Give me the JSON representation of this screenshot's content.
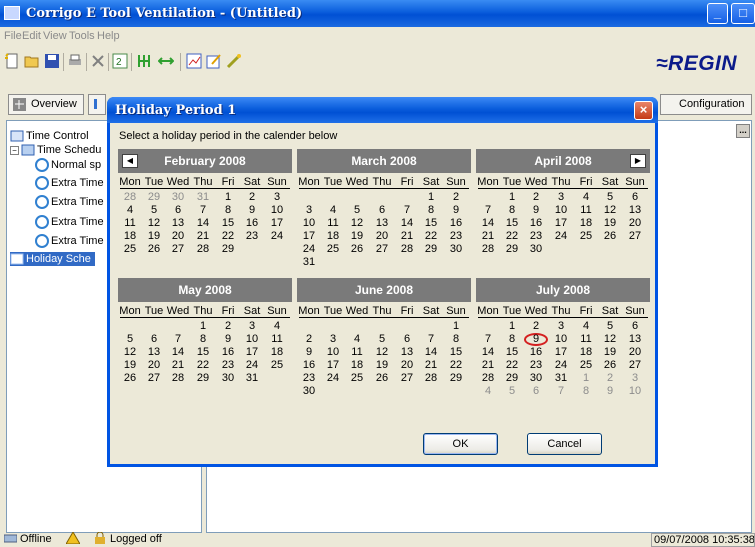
{
  "window": {
    "title": "Corrigo E Tool Ventilation - (Untitled)",
    "min": "_",
    "max": "□"
  },
  "menu": [
    {
      "label": "File"
    },
    {
      "label": "Edit"
    },
    {
      "label": "View"
    },
    {
      "label": "Tools"
    },
    {
      "label": "Help"
    }
  ],
  "toolbar": {
    "logo": "≈REGIN"
  },
  "tabs": {
    "overview": "Overview",
    "configuration": "Configuration"
  },
  "tree": {
    "items": [
      "Time Control",
      "Time Schedu",
      "Normal sp",
      "Extra Time",
      "Extra Time",
      "Extra Time",
      "Extra Time",
      "Holiday Sche"
    ]
  },
  "more_button": "...",
  "status": {
    "offline": "Offline",
    "logged": "Logged off",
    "datetime": "09/07/2008 10:35:38"
  },
  "dialog": {
    "title": "Holiday Period 1",
    "close": "×",
    "instruction": "Select a holiday period in the calender below",
    "ok": "OK",
    "cancel": "Cancel",
    "weekdays": [
      "Mon",
      "Tue",
      "Wed",
      "Thu",
      "Fri",
      "Sat",
      "Sun"
    ],
    "months": [
      {
        "name": "February 2008",
        "nav": "prev",
        "rows": [
          [
            {
              "d": "28",
              "o": 1
            },
            {
              "d": "29",
              "o": 1
            },
            {
              "d": "30",
              "o": 1
            },
            {
              "d": "31",
              "o": 1
            },
            {
              "d": "1"
            },
            {
              "d": "2"
            },
            {
              "d": "3"
            }
          ],
          [
            {
              "d": "4"
            },
            {
              "d": "5"
            },
            {
              "d": "6"
            },
            {
              "d": "7"
            },
            {
              "d": "8"
            },
            {
              "d": "9"
            },
            {
              "d": "10"
            }
          ],
          [
            {
              "d": "11"
            },
            {
              "d": "12"
            },
            {
              "d": "13"
            },
            {
              "d": "14"
            },
            {
              "d": "15"
            },
            {
              "d": "16"
            },
            {
              "d": "17"
            }
          ],
          [
            {
              "d": "18"
            },
            {
              "d": "19"
            },
            {
              "d": "20"
            },
            {
              "d": "21"
            },
            {
              "d": "22"
            },
            {
              "d": "23"
            },
            {
              "d": "24"
            }
          ],
          [
            {
              "d": "25"
            },
            {
              "d": "26"
            },
            {
              "d": "27"
            },
            {
              "d": "28"
            },
            {
              "d": "29"
            }
          ]
        ]
      },
      {
        "name": "March 2008",
        "nav": "",
        "rows": [
          [
            {
              "d": ""
            },
            {
              "d": ""
            },
            {
              "d": ""
            },
            {
              "d": ""
            },
            {
              "d": ""
            },
            {
              "d": "1"
            },
            {
              "d": "2"
            }
          ],
          [
            {
              "d": "3"
            },
            {
              "d": "4"
            },
            {
              "d": "5"
            },
            {
              "d": "6"
            },
            {
              "d": "7"
            },
            {
              "d": "8"
            },
            {
              "d": "9"
            }
          ],
          [
            {
              "d": "10"
            },
            {
              "d": "11"
            },
            {
              "d": "12"
            },
            {
              "d": "13"
            },
            {
              "d": "14"
            },
            {
              "d": "15"
            },
            {
              "d": "16"
            }
          ],
          [
            {
              "d": "17"
            },
            {
              "d": "18"
            },
            {
              "d": "19"
            },
            {
              "d": "20"
            },
            {
              "d": "21"
            },
            {
              "d": "22"
            },
            {
              "d": "23"
            }
          ],
          [
            {
              "d": "24"
            },
            {
              "d": "25"
            },
            {
              "d": "26"
            },
            {
              "d": "27"
            },
            {
              "d": "28"
            },
            {
              "d": "29"
            },
            {
              "d": "30"
            }
          ],
          [
            {
              "d": "31"
            }
          ]
        ]
      },
      {
        "name": "April 2008",
        "nav": "next",
        "rows": [
          [
            {
              "d": ""
            },
            {
              "d": "1"
            },
            {
              "d": "2"
            },
            {
              "d": "3"
            },
            {
              "d": "4"
            },
            {
              "d": "5"
            },
            {
              "d": "6"
            }
          ],
          [
            {
              "d": "7"
            },
            {
              "d": "8"
            },
            {
              "d": "9"
            },
            {
              "d": "10"
            },
            {
              "d": "11"
            },
            {
              "d": "12"
            },
            {
              "d": "13"
            }
          ],
          [
            {
              "d": "14"
            },
            {
              "d": "15"
            },
            {
              "d": "16"
            },
            {
              "d": "17"
            },
            {
              "d": "18"
            },
            {
              "d": "19"
            },
            {
              "d": "20"
            }
          ],
          [
            {
              "d": "21"
            },
            {
              "d": "22"
            },
            {
              "d": "23"
            },
            {
              "d": "24"
            },
            {
              "d": "25"
            },
            {
              "d": "26"
            },
            {
              "d": "27"
            }
          ],
          [
            {
              "d": "28"
            },
            {
              "d": "29"
            },
            {
              "d": "30"
            }
          ]
        ]
      },
      {
        "name": "May 2008",
        "nav": "",
        "rows": [
          [
            {
              "d": ""
            },
            {
              "d": ""
            },
            {
              "d": ""
            },
            {
              "d": "1"
            },
            {
              "d": "2"
            },
            {
              "d": "3"
            },
            {
              "d": "4"
            }
          ],
          [
            {
              "d": "5"
            },
            {
              "d": "6"
            },
            {
              "d": "7"
            },
            {
              "d": "8"
            },
            {
              "d": "9"
            },
            {
              "d": "10"
            },
            {
              "d": "11"
            }
          ],
          [
            {
              "d": "12"
            },
            {
              "d": "13"
            },
            {
              "d": "14"
            },
            {
              "d": "15"
            },
            {
              "d": "16"
            },
            {
              "d": "17"
            },
            {
              "d": "18"
            }
          ],
          [
            {
              "d": "19"
            },
            {
              "d": "20"
            },
            {
              "d": "21"
            },
            {
              "d": "22"
            },
            {
              "d": "23"
            },
            {
              "d": "24"
            },
            {
              "d": "25"
            }
          ],
          [
            {
              "d": "26"
            },
            {
              "d": "27"
            },
            {
              "d": "28"
            },
            {
              "d": "29"
            },
            {
              "d": "30"
            },
            {
              "d": "31"
            }
          ]
        ]
      },
      {
        "name": "June 2008",
        "nav": "",
        "rows": [
          [
            {
              "d": ""
            },
            {
              "d": ""
            },
            {
              "d": ""
            },
            {
              "d": ""
            },
            {
              "d": ""
            },
            {
              "d": ""
            },
            {
              "d": "1"
            }
          ],
          [
            {
              "d": "2"
            },
            {
              "d": "3"
            },
            {
              "d": "4"
            },
            {
              "d": "5"
            },
            {
              "d": "6"
            },
            {
              "d": "7"
            },
            {
              "d": "8"
            }
          ],
          [
            {
              "d": "9"
            },
            {
              "d": "10"
            },
            {
              "d": "11"
            },
            {
              "d": "12"
            },
            {
              "d": "13"
            },
            {
              "d": "14"
            },
            {
              "d": "15"
            }
          ],
          [
            {
              "d": "16"
            },
            {
              "d": "17"
            },
            {
              "d": "18"
            },
            {
              "d": "19"
            },
            {
              "d": "20"
            },
            {
              "d": "21"
            },
            {
              "d": "22"
            }
          ],
          [
            {
              "d": "23"
            },
            {
              "d": "24"
            },
            {
              "d": "25"
            },
            {
              "d": "26"
            },
            {
              "d": "27"
            },
            {
              "d": "28"
            },
            {
              "d": "29"
            }
          ],
          [
            {
              "d": "30"
            }
          ]
        ]
      },
      {
        "name": "July 2008",
        "nav": "",
        "rows": [
          [
            {
              "d": ""
            },
            {
              "d": "1"
            },
            {
              "d": "2"
            },
            {
              "d": "3"
            },
            {
              "d": "4"
            },
            {
              "d": "5"
            },
            {
              "d": "6"
            }
          ],
          [
            {
              "d": "7"
            },
            {
              "d": "8"
            },
            {
              "d": "9",
              "t": 1
            },
            {
              "d": "10"
            },
            {
              "d": "11"
            },
            {
              "d": "12"
            },
            {
              "d": "13"
            }
          ],
          [
            {
              "d": "14"
            },
            {
              "d": "15"
            },
            {
              "d": "16"
            },
            {
              "d": "17"
            },
            {
              "d": "18"
            },
            {
              "d": "19"
            },
            {
              "d": "20"
            }
          ],
          [
            {
              "d": "21"
            },
            {
              "d": "22"
            },
            {
              "d": "23"
            },
            {
              "d": "24"
            },
            {
              "d": "25"
            },
            {
              "d": "26"
            },
            {
              "d": "27"
            }
          ],
          [
            {
              "d": "28"
            },
            {
              "d": "29"
            },
            {
              "d": "30"
            },
            {
              "d": "31"
            },
            {
              "d": "1",
              "o": 1
            },
            {
              "d": "2",
              "o": 1
            },
            {
              "d": "3",
              "o": 1
            }
          ],
          [
            {
              "d": "4",
              "o": 1
            },
            {
              "d": "5",
              "o": 1
            },
            {
              "d": "6",
              "o": 1
            },
            {
              "d": "7",
              "o": 1
            },
            {
              "d": "8",
              "o": 1
            },
            {
              "d": "9",
              "o": 1
            },
            {
              "d": "10",
              "o": 1
            }
          ]
        ]
      }
    ]
  }
}
